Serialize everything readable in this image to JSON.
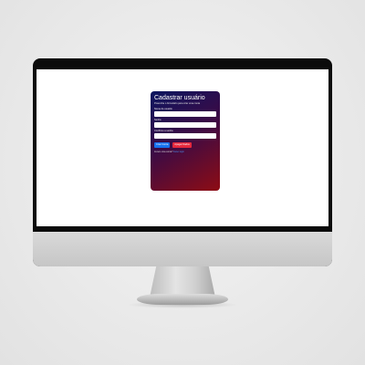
{
  "form": {
    "title": "Cadastrar usuário",
    "subtitle": "Preencha o formulário para criar uma conta",
    "fields": [
      {
        "label": "Nome de usuário",
        "value": ""
      },
      {
        "label": "Senha",
        "value": ""
      },
      {
        "label": "Confirme a senha",
        "value": ""
      }
    ],
    "buttons": {
      "submit": "Criar Conta",
      "clear": "Apagar Dados"
    },
    "footer": {
      "text": "Já tem uma conta?",
      "link": "Fazer login"
    }
  },
  "colors": {
    "card_gradient_start": "#0c1660",
    "card_gradient_end": "#8e0c14",
    "primary": "#1672f0",
    "danger": "#e5283d"
  }
}
